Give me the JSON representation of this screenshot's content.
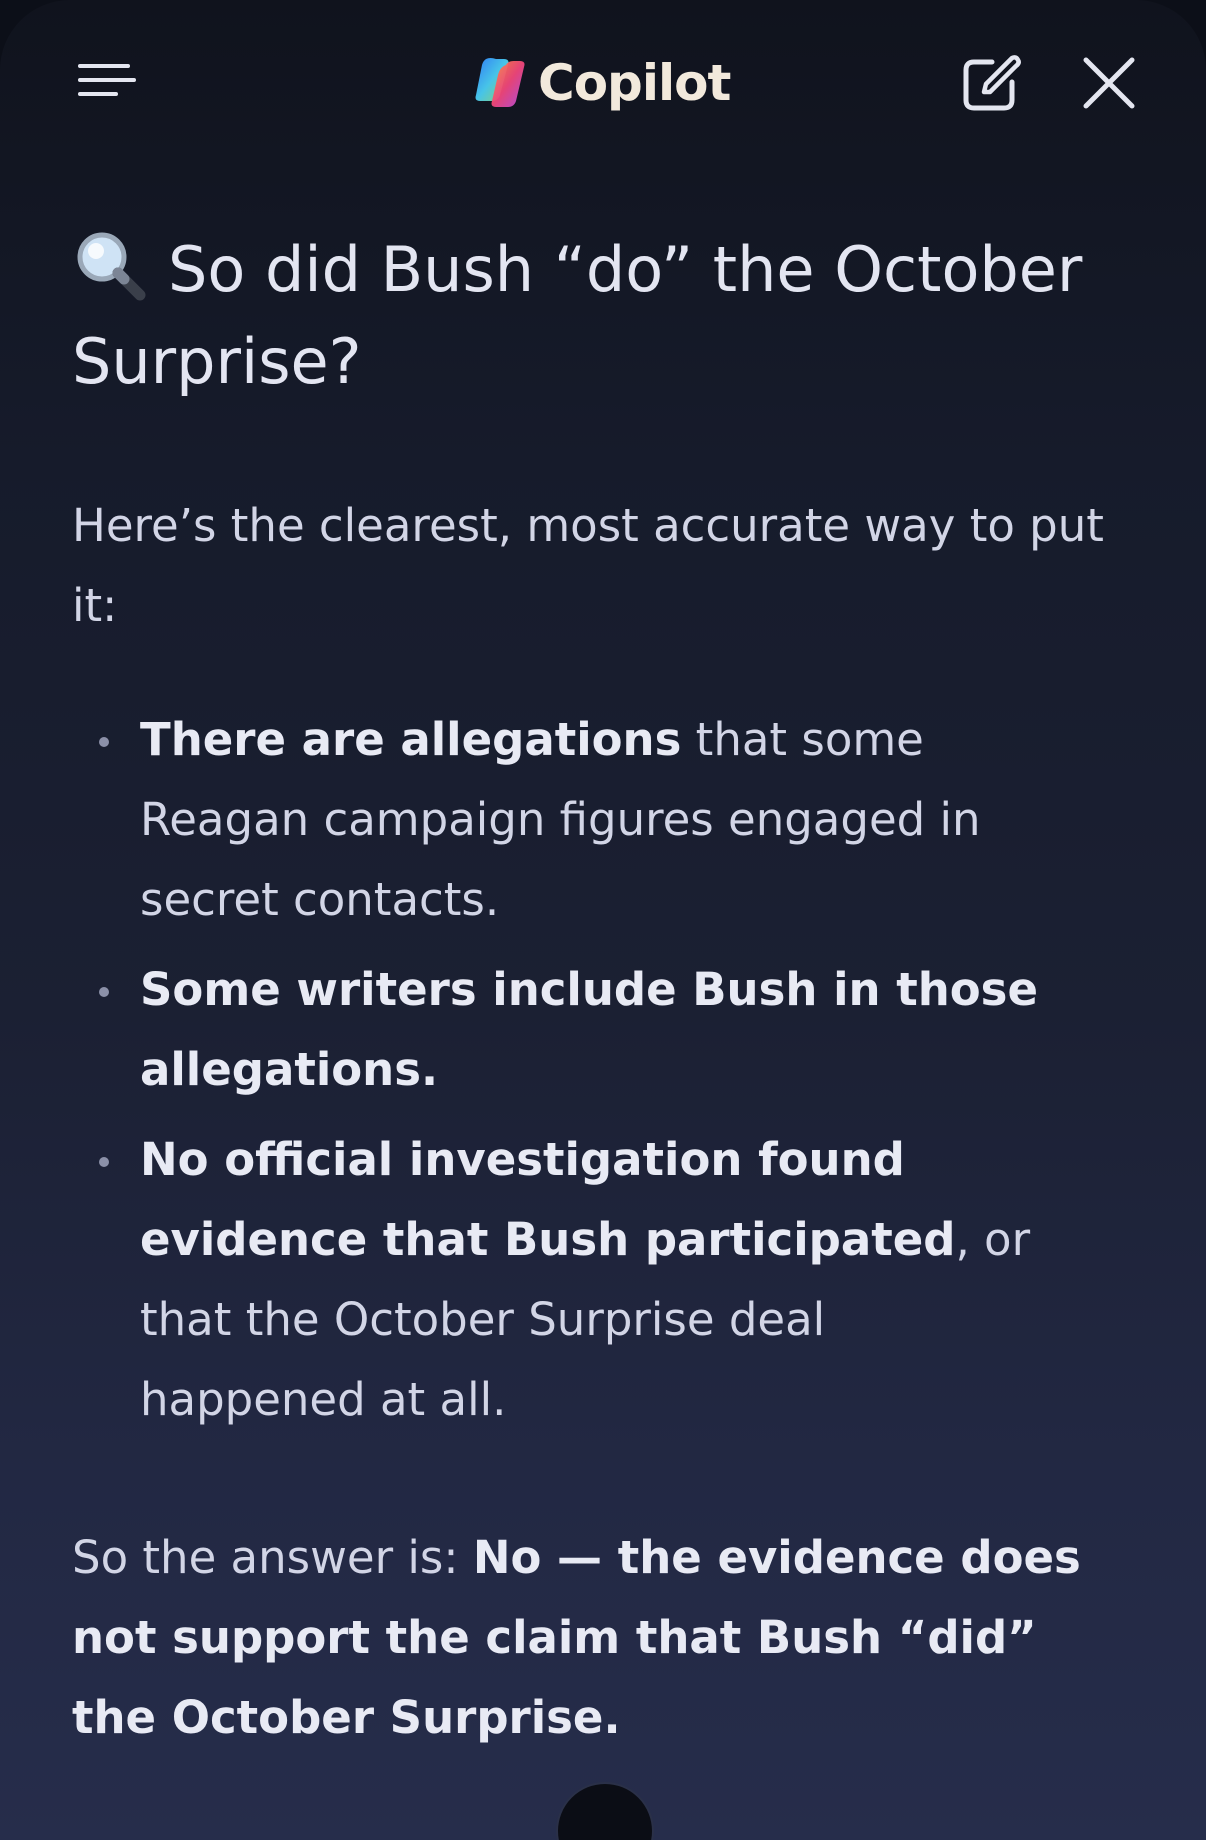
{
  "app": {
    "name": "Copilot",
    "accent": "#f2e9dc"
  },
  "topbar": {
    "menu_icon": "hamburger-menu-icon",
    "logo_icon": "copilot-logo-icon",
    "new_chat_icon": "compose-icon",
    "close_icon": "close-icon"
  },
  "message": {
    "heading_icon": "magnifying-glass-icon",
    "heading": "So did Bush “do” the October Surprise?",
    "intro": "Here’s the clearest, most accurate way to put it:",
    "bullets": [
      {
        "bold": "There are allegations",
        "rest": " that some Reagan campaign figures engaged in secret contacts."
      },
      {
        "bold": "Some writers include Bush in those allegations.",
        "rest": ""
      },
      {
        "bold": "No official investigation found evidence that Bush participated",
        "rest": ", or that the October Surprise deal happened at all."
      }
    ],
    "answer_lead": "So the answer is: ",
    "answer_bold": "No — the evidence does not support the claim that Bush “did” the October Surprise."
  }
}
